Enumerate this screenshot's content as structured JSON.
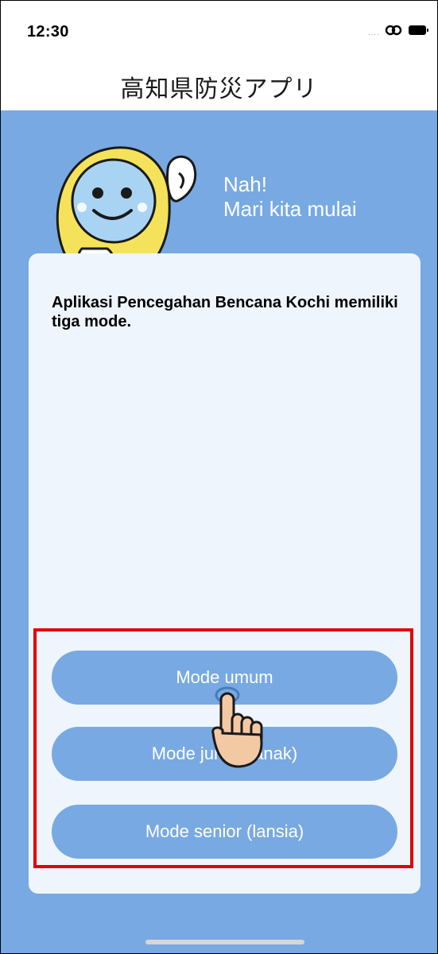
{
  "status_bar": {
    "time": "12:30",
    "signal_dots": "....",
    "icons": [
      "signal-dots-icon",
      "link-icon",
      "battery-icon"
    ]
  },
  "header": {
    "title": "高知県防災アプリ"
  },
  "greeting": {
    "line1": "Nah!",
    "line2": "Mari kita mulai"
  },
  "card": {
    "text": "Aplikasi Pencegahan Bencana Kochi memiliki tiga mode."
  },
  "modes": {
    "general_label": "Mode umum",
    "junior_label": "Mode junior (anak)",
    "senior_label": "Mode senior (lansia)"
  },
  "colors": {
    "background_blue": "#78a9e2",
    "card_bg": "#eef5fc",
    "highlight_red": "#e00000",
    "mascot_face": "#a9d3f2",
    "raincoat_yellow": "#f4e35a"
  }
}
